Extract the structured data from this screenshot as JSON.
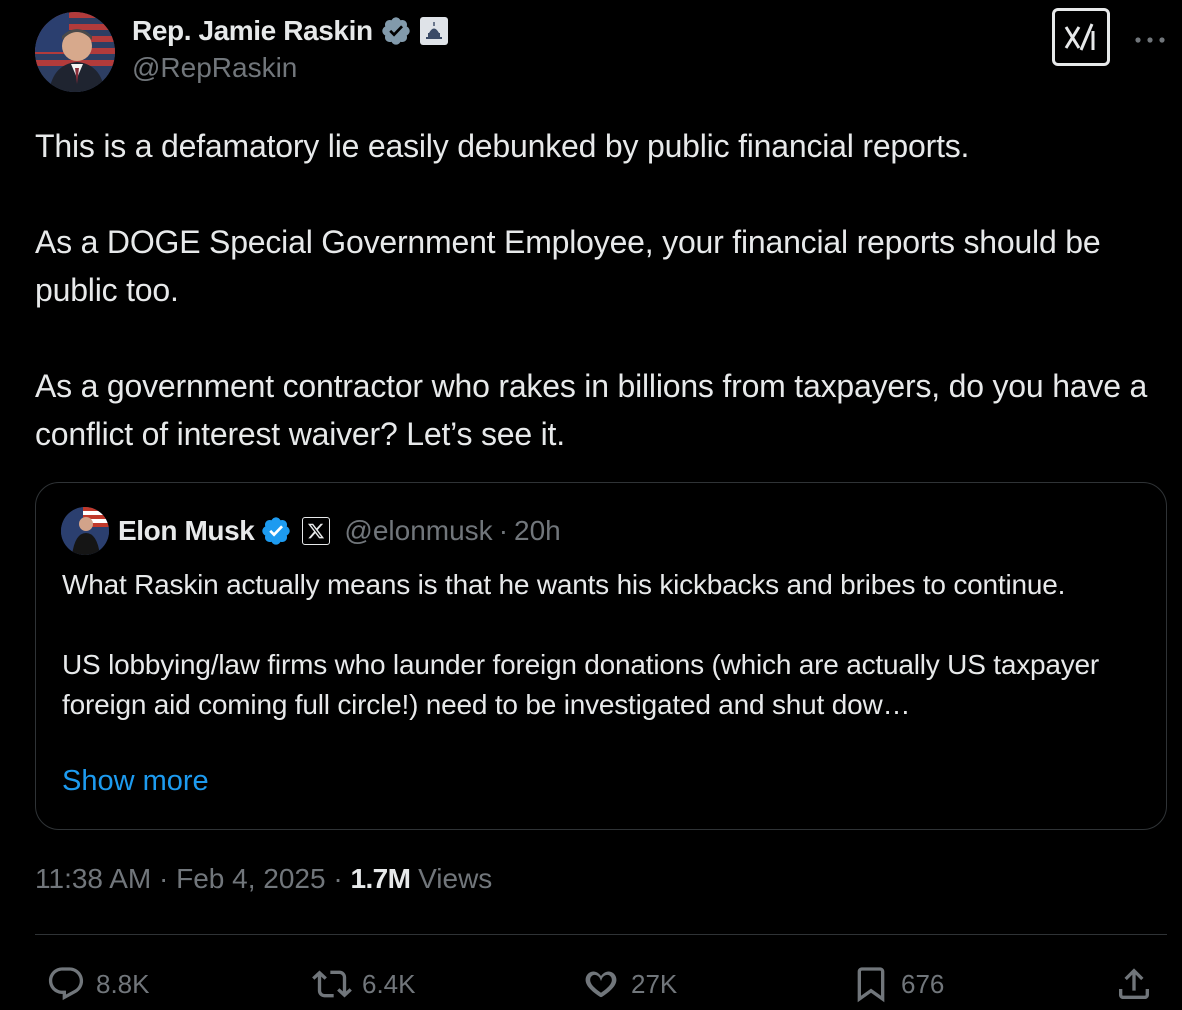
{
  "author": {
    "display_name": "Rep. Jamie Raskin",
    "handle": "@RepRaskin",
    "verified_icon": "verified-badge-icon",
    "affiliation_icon": "capitol-building-icon"
  },
  "header": {
    "grok_icon": "grok-icon",
    "more_icon": "more-dots-icon"
  },
  "body": {
    "paragraphs": [
      "This is a defamatory lie easily debunked by public financial reports.",
      "As a DOGE Special Government Employee, your financial reports should be public too.",
      "As a government contractor who rakes in billions from taxpayers, do you have a conflict of interest waiver? Let’s see it."
    ]
  },
  "quote": {
    "display_name": "Elon Musk",
    "handle": "@elonmusk",
    "separator": "·",
    "time": "20h",
    "paragraphs": [
      "What Raskin actually means is that he wants his kickbacks and bribes to continue.",
      "US lobbying/law firms who launder foreign donations (which are actually US taxpayer foreign aid coming full circle!) need to be investigated and shut dow…"
    ],
    "show_more": "Show more"
  },
  "meta": {
    "time": "11:38 AM",
    "sep1": "·",
    "date": "Feb 4, 2025",
    "sep2": "·",
    "views_count": "1.7M",
    "views_label": "Views"
  },
  "actions": {
    "replies": "8.8K",
    "reposts": "6.4K",
    "likes": "27K",
    "bookmarks": "676"
  },
  "colors": {
    "background": "#000000",
    "text": "#e7e9ea",
    "secondary": "#71767b",
    "link": "#1d9bf0",
    "verified": "#1d9bf0",
    "border": "#2f3336"
  }
}
